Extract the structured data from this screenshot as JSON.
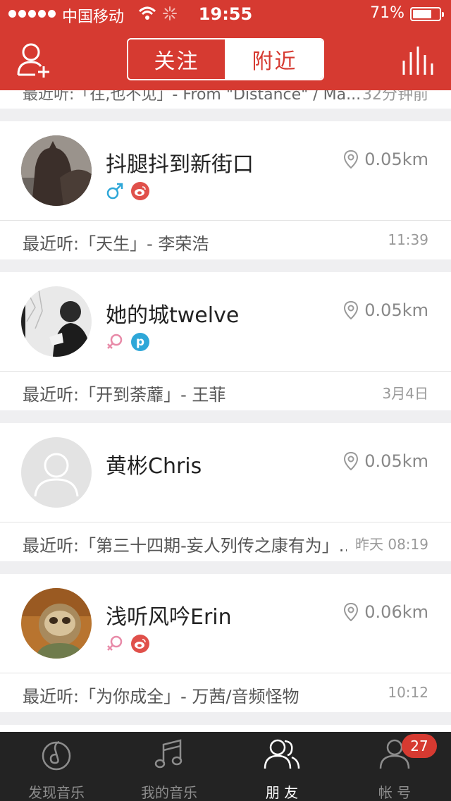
{
  "status_bar": {
    "carrier": "中国移动",
    "time": "19:55",
    "battery": "71%",
    "battery_level": 0.71
  },
  "header": {
    "tabs": [
      {
        "label": "关注",
        "selected": false
      },
      {
        "label": "附近",
        "selected": true
      }
    ],
    "left_icon": "add-friend-icon",
    "right_icon": "stats-icon"
  },
  "partial_item": {
    "recent": "最近听:「往,也不见」- From \"Distance\" / Ma...",
    "time": "32分钟前"
  },
  "users": [
    {
      "name": "抖腿抖到新街口",
      "distance": "0.05km",
      "gender": "male",
      "gender_symbol": "♂",
      "badge": "weibo",
      "recent": "最近听:「天生」- 李荣浩",
      "time": "11:39"
    },
    {
      "name": "她的城twelve",
      "distance": "0.05km",
      "gender": "female",
      "gender_symbol": "♀",
      "badge": "p",
      "badge_text": "p",
      "recent": "最近听:「开到荼蘼」- 王菲",
      "time": "3月4日"
    },
    {
      "name": "黄彬Chris",
      "distance": "0.05km",
      "recent": "最近听:「第三十四期-妄人列传之康有为」...",
      "time": "昨天 08:19"
    },
    {
      "name": "浅听风吟Erin",
      "distance": "0.06km",
      "gender": "female",
      "gender_symbol": "♀",
      "badge": "weibo",
      "recent": "最近听:「为你成全」- 万茜/音频怪物",
      "time": "10:12"
    }
  ],
  "tabbar": {
    "tabs": [
      {
        "label": "发现音乐",
        "icon": "discover-music-icon"
      },
      {
        "label": "我的音乐",
        "icon": "my-music-icon"
      },
      {
        "label": "朋 友",
        "icon": "friends-icon",
        "active": true
      },
      {
        "label": "帐 号",
        "icon": "account-icon"
      }
    ],
    "account_badge": "27"
  },
  "colors": {
    "brand_red": "#d63a31",
    "tabbar_bg": "#232323",
    "male_blue": "#2ea7d8",
    "female_pink": "#e88aa8"
  }
}
